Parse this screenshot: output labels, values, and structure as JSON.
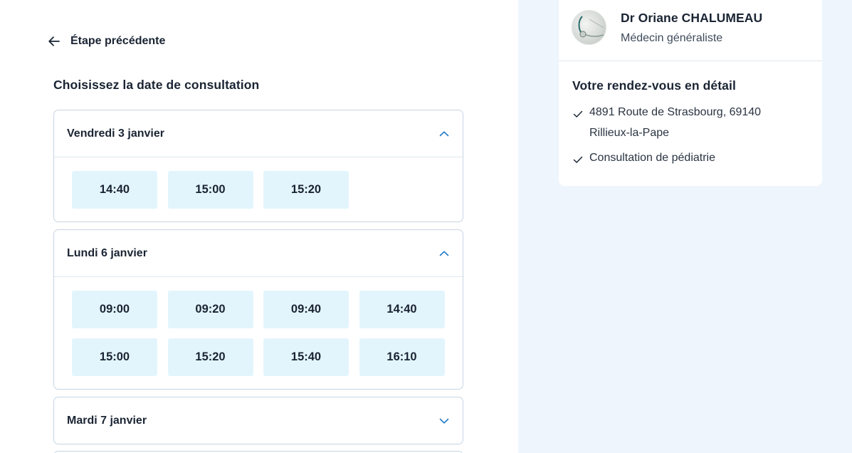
{
  "nav": {
    "back_label": "Étape précédente"
  },
  "booking": {
    "section_title": "Choisissez la date de consultation",
    "days": [
      {
        "label": "Vendredi 3 janvier",
        "expanded": true,
        "slots": [
          "14:40",
          "15:00",
          "15:20"
        ]
      },
      {
        "label": "Lundi 6 janvier",
        "expanded": true,
        "slots": [
          "09:00",
          "09:20",
          "09:40",
          "14:40",
          "15:00",
          "15:20",
          "15:40",
          "16:10"
        ]
      },
      {
        "label": "Mardi 7 janvier",
        "expanded": false,
        "slots": []
      }
    ]
  },
  "doctor": {
    "name": "Dr Oriane CHALUMEAU",
    "specialty": "Médecin généraliste"
  },
  "appointment": {
    "title": "Votre rendez-vous en détail",
    "address": "4891 Route de Strasbourg, 69140 Rillieux-la-Pape",
    "consultation": "Consultation de pédiatrie"
  },
  "colors": {
    "accent": "#1f7ac9",
    "slot_bg": "#e3f5fc",
    "panel_bg": "#eef5fd",
    "border": "#c7d6e2"
  }
}
